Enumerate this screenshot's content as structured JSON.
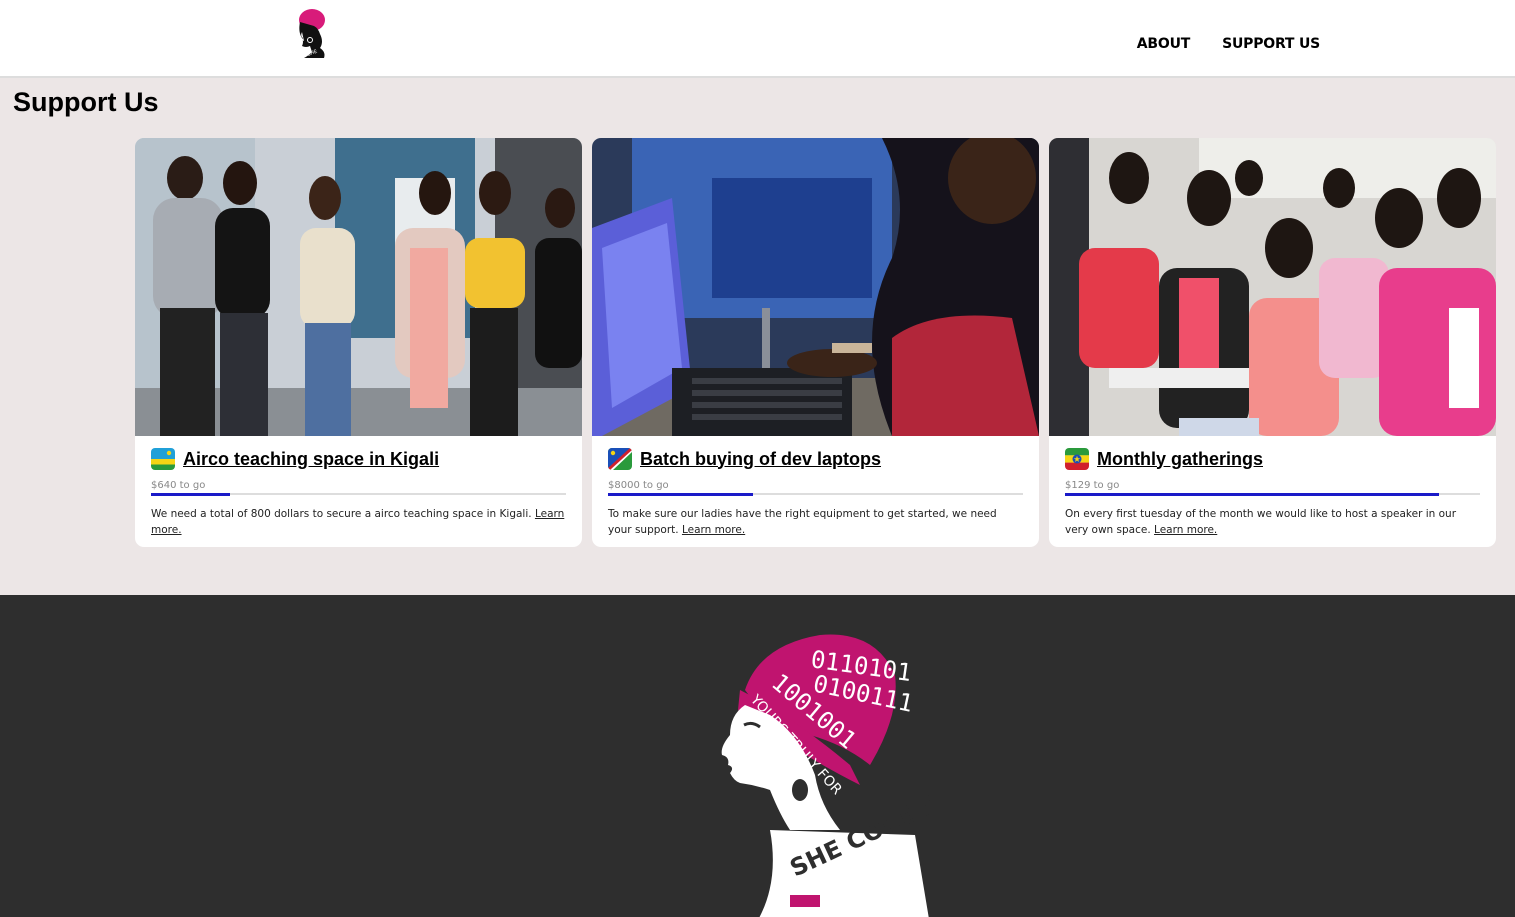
{
  "nav": {
    "about": "ABOUT",
    "support": "SUPPORT US"
  },
  "page": {
    "title": "Support Us"
  },
  "cards": [
    {
      "flag": "rwanda-flag-icon",
      "title": "Airco teaching space in Kigali",
      "togo": "$640 to go",
      "progress": 0.19,
      "desc": "We need a total of 800 dollars to secure a airco teaching space in Kigali.",
      "learn": "Learn more."
    },
    {
      "flag": "namibia-flag-icon",
      "title": "Batch buying of dev laptops",
      "togo": "$8000 to go",
      "progress": 0.35,
      "desc": "To make sure our ladies have the right equipment to get started, we need your support.",
      "learn": "Learn more."
    },
    {
      "flag": "ethiopia-flag-icon",
      "title": "Monthly gatherings",
      "togo": "$129 to go",
      "progress": 0.9,
      "desc": "On every first tuesday of the month we would like to host a speaker in our very own space.",
      "learn": "Learn more."
    }
  ],
  "colors": {
    "accent": "#c0146f",
    "progress": "#1a1ac8",
    "footer": "#2e2e2e",
    "background": "#ece6e6"
  },
  "logo_lettering": {
    "binary1": "0110101",
    "binary2": "1001001",
    "binary3": "0100111",
    "band": "YOURS TRULY FOR",
    "neck": "SHE CODE AFRICA"
  }
}
